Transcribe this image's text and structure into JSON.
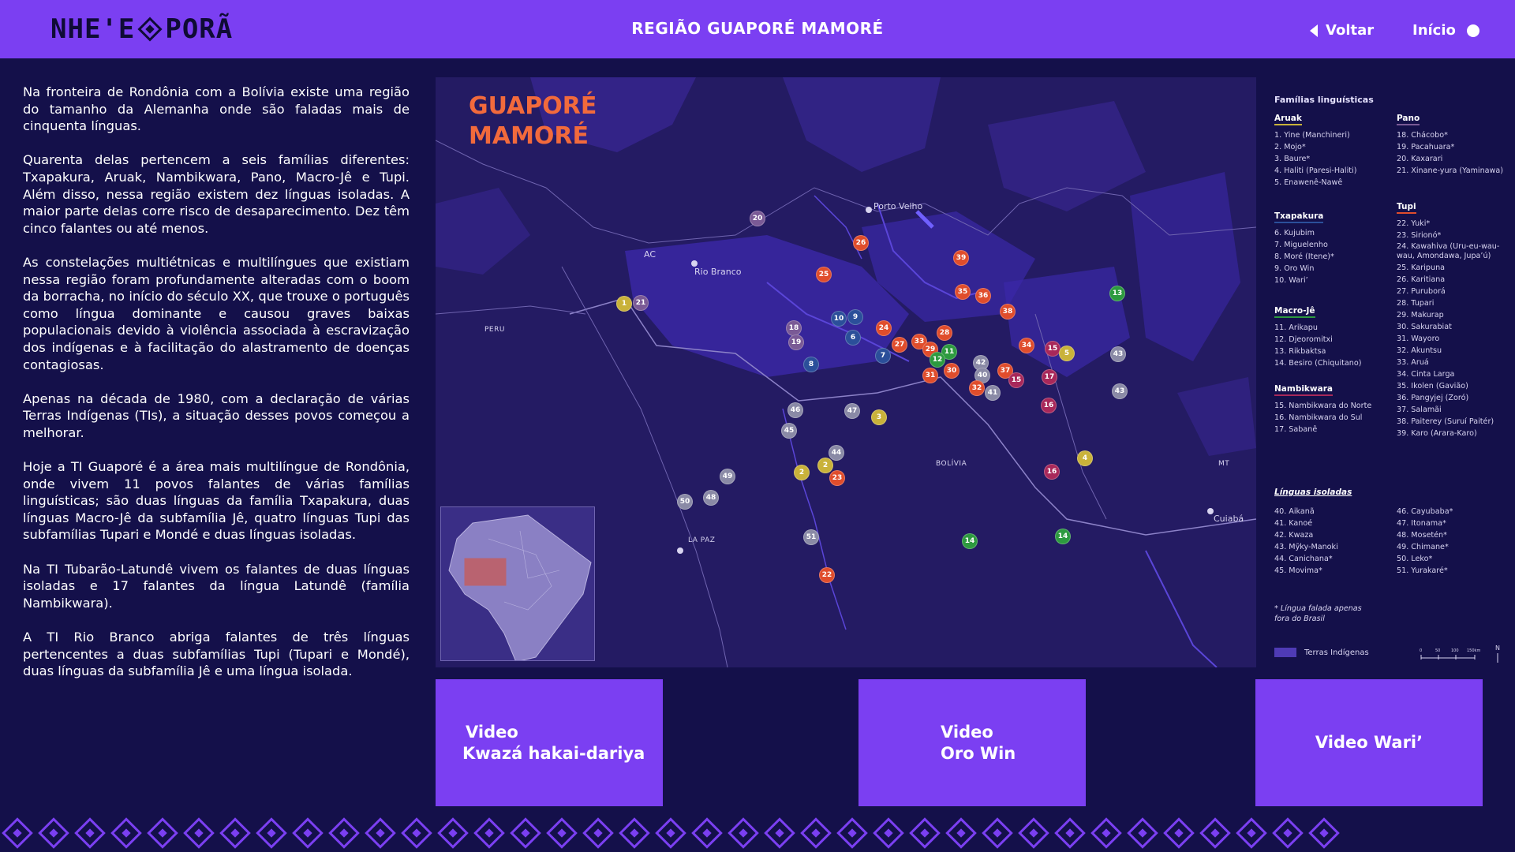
{
  "header": {
    "logo_text_left": "NHE'E",
    "logo_text_right": "PORÃ",
    "title": "REGIÃO GUAPORÉ MAMORÉ",
    "back_label": "Voltar",
    "home_label": "Início"
  },
  "intro": {
    "paragraphs": [
      "Na fronteira de Rondônia com a Bolívia existe uma região do tamanho da Alemanha onde são faladas mais de cinquenta línguas.",
      "Quarenta delas pertencem a seis famílias diferentes: Txapakura, Aruak, Nambikwara, Pano, Macro-Jê e Tupi. Além disso, nessa região existem dez línguas isoladas. A maior parte delas corre risco de desaparecimento. Dez têm cinco falantes ou até menos.",
      "As constelações multiétnicas e multilíngues que existiam nessa região foram profundamente alteradas com o boom da borracha, no início do século XX, que trouxe o português como língua dominante e causou graves baixas populacionais devido à violência associada à escravização dos indígenas e à facilitação do alastramento de doenças contagiosas.",
      "Apenas na década de 1980, com a declaração de várias Terras Indígenas (TIs), a situação desses povos começou a melhorar.",
      "Hoje a TI Guaporé é a área mais multilíngue de Rondônia, onde vivem 11 povos falantes de várias famílias linguísticas; são duas línguas da família Txapakura, duas línguas Macro-Jê da subfamília Jê, quatro línguas Tupi das subfamílias Tupari e Mondé e duas línguas isoladas.",
      "Na TI Tubarão-Latundê vivem os falantes de duas línguas isoladas e 17 falantes da língua Latundê (família Nambikwara).",
      "A TI Rio Branco abriga falantes de três línguas pertencentes a duas subfamílias Tupi (Tupari e Mondé), duas línguas da subfamília Jê e uma língua isolada."
    ]
  },
  "map": {
    "title_line1": "GUAPORÉ",
    "title_line2": "MAMORÉ",
    "places": {
      "porto_velho": "Porto Velho",
      "rio_branco": "Rio Branco",
      "ac": "AC",
      "peru": "PERU",
      "bolivia": "BOLÍVIA",
      "mt": "MT",
      "cuiaba": "Cuiabá",
      "la_paz": "LA PAZ"
    },
    "colors": {
      "aruak": "#c9b23a",
      "txapakura": "#2b4f9a",
      "macro_je": "#2d9a3f",
      "nambikwara": "#a8285a",
      "pano": "#7a5a96",
      "tupi": "#e04d2c",
      "isoladas": "#8a8aa6"
    },
    "markers": [
      {
        "n": "1",
        "f": "aruak"
      },
      {
        "n": "21",
        "f": "pano"
      },
      {
        "n": "20",
        "f": "pano"
      },
      {
        "n": "26",
        "f": "tupi"
      },
      {
        "n": "25",
        "f": "tupi"
      },
      {
        "n": "39",
        "f": "tupi"
      },
      {
        "n": "35",
        "f": "tupi"
      },
      {
        "n": "36",
        "f": "tupi"
      },
      {
        "n": "38",
        "f": "tupi"
      },
      {
        "n": "13",
        "f": "macro_je"
      },
      {
        "n": "10",
        "f": "txapakura"
      },
      {
        "n": "9",
        "f": "txapakura"
      },
      {
        "n": "18",
        "f": "pano"
      },
      {
        "n": "19",
        "f": "pano"
      },
      {
        "n": "6",
        "f": "txapakura"
      },
      {
        "n": "24",
        "f": "tupi"
      },
      {
        "n": "28",
        "f": "tupi"
      },
      {
        "n": "27",
        "f": "tupi"
      },
      {
        "n": "33",
        "f": "tupi"
      },
      {
        "n": "29",
        "f": "tupi"
      },
      {
        "n": "11",
        "f": "macro_je"
      },
      {
        "n": "12",
        "f": "macro_je"
      },
      {
        "n": "7",
        "f": "txapakura"
      },
      {
        "n": "34",
        "f": "tupi"
      },
      {
        "n": "15",
        "f": "nambikwara"
      },
      {
        "n": "5",
        "f": "aruak"
      },
      {
        "n": "43",
        "f": "isoladas"
      },
      {
        "n": "8",
        "f": "txapakura"
      },
      {
        "n": "42",
        "f": "isoladas"
      },
      {
        "n": "31",
        "f": "tupi"
      },
      {
        "n": "30",
        "f": "tupi"
      },
      {
        "n": "40",
        "f": "isoladas"
      },
      {
        "n": "37",
        "f": "tupi"
      },
      {
        "n": "15",
        "f": "nambikwara"
      },
      {
        "n": "17",
        "f": "nambikwara"
      },
      {
        "n": "32",
        "f": "tupi"
      },
      {
        "n": "41",
        "f": "isoladas"
      },
      {
        "n": "43",
        "f": "isoladas"
      },
      {
        "n": "16",
        "f": "nambikwara"
      },
      {
        "n": "46",
        "f": "isoladas"
      },
      {
        "n": "47",
        "f": "isoladas"
      },
      {
        "n": "3",
        "f": "aruak"
      },
      {
        "n": "45",
        "f": "isoladas"
      },
      {
        "n": "44",
        "f": "isoladas"
      },
      {
        "n": "4",
        "f": "aruak"
      },
      {
        "n": "2",
        "f": "aruak"
      },
      {
        "n": "2",
        "f": "aruak"
      },
      {
        "n": "23",
        "f": "tupi"
      },
      {
        "n": "16",
        "f": "nambikwara"
      },
      {
        "n": "49",
        "f": "isoladas"
      },
      {
        "n": "48",
        "f": "isoladas"
      },
      {
        "n": "50",
        "f": "isoladas"
      },
      {
        "n": "14",
        "f": "macro_je"
      },
      {
        "n": "14",
        "f": "macro_je"
      },
      {
        "n": "51",
        "f": "isoladas"
      },
      {
        "n": "22",
        "f": "tupi"
      }
    ]
  },
  "legend": {
    "title": "Famílias linguísticas",
    "families_left": [
      {
        "name": "Aruak",
        "color": "#c9b23a",
        "items": [
          "1. Yine (Manchineri)",
          "2. Mojo*",
          "3. Baure*",
          "4. Haliti (Paresi-Haliti)",
          "5. Enawenê-Nawê"
        ]
      },
      {
        "name": "Txapakura",
        "color": "#2b4f9a",
        "items": [
          "6. Kujubim",
          "7. Miguelenho",
          "8. Moré (Itene)*",
          "9. Oro Win",
          "10. Wari’"
        ]
      },
      {
        "name": "Macro-Jê",
        "color": "#2d9a3f",
        "items": [
          "11. Arikapu",
          "12. Djeoromitxi",
          "13. Rikbaktsa",
          "14. Besiro (Chiquitano)"
        ]
      },
      {
        "name": "Nambikwara",
        "color": "#a8285a",
        "items": [
          "15. Nambikwara do Norte",
          "16. Nambikwara do Sul",
          "17. Sabanê"
        ]
      }
    ],
    "families_right": [
      {
        "name": "Pano",
        "color": "#7a5a96",
        "items": [
          "18. Chácobo*",
          "19. Pacahuara*",
          "20. Kaxarari",
          "21. Xinane-yura (Yaminawa)"
        ]
      },
      {
        "name": "Tupi",
        "color": "#e04d2c",
        "items": [
          "22. Yuki*",
          "23. Sirionó*",
          "24. Kawahiva (Uru-eu-wau-wau, Amondawa, Jupa’ú)",
          "25. Karipuna",
          "26. Karitiana",
          "27. Puruborá",
          "28. Tupari",
          "29. Makurap",
          "30. Sakurabiat",
          "31. Wayoro",
          "32. Akuntsu",
          "33. Aruá",
          "34. Cinta Larga",
          "35. Ikolen (Gavião)",
          "36. Pangyjej (Zoró)",
          "37. Salamãi",
          "38. Paiterey (Suruí Paitér)",
          "39. Karo (Arara-Karo)"
        ]
      }
    ],
    "isolated_title": "Línguas isoladas",
    "isolated_left": [
      "40. Aikanã",
      "41. Kanoé",
      "42. Kwaza",
      "43. Mỹky-Manoki",
      "44. Canichana*",
      "45. Movima*"
    ],
    "isolated_right": [
      "46. Cayubaba*",
      "47. Itonama*",
      "48. Mosetén*",
      "49. Chimane*",
      "50. Leko*",
      "51. Yurakaré*"
    ],
    "note": "* Língua falada apenas fora do Brasil",
    "ti_label": "Terras Indígenas",
    "scale_labels": [
      "0",
      "50",
      "100",
      "150km"
    ],
    "north": "N"
  },
  "videos": [
    {
      "line1": "Video",
      "line2": "Kwazá hakai-dariya"
    },
    {
      "line1": "Video",
      "line2": "Oro Win"
    },
    {
      "line1": "Video Wari’",
      "line2": ""
    }
  ]
}
